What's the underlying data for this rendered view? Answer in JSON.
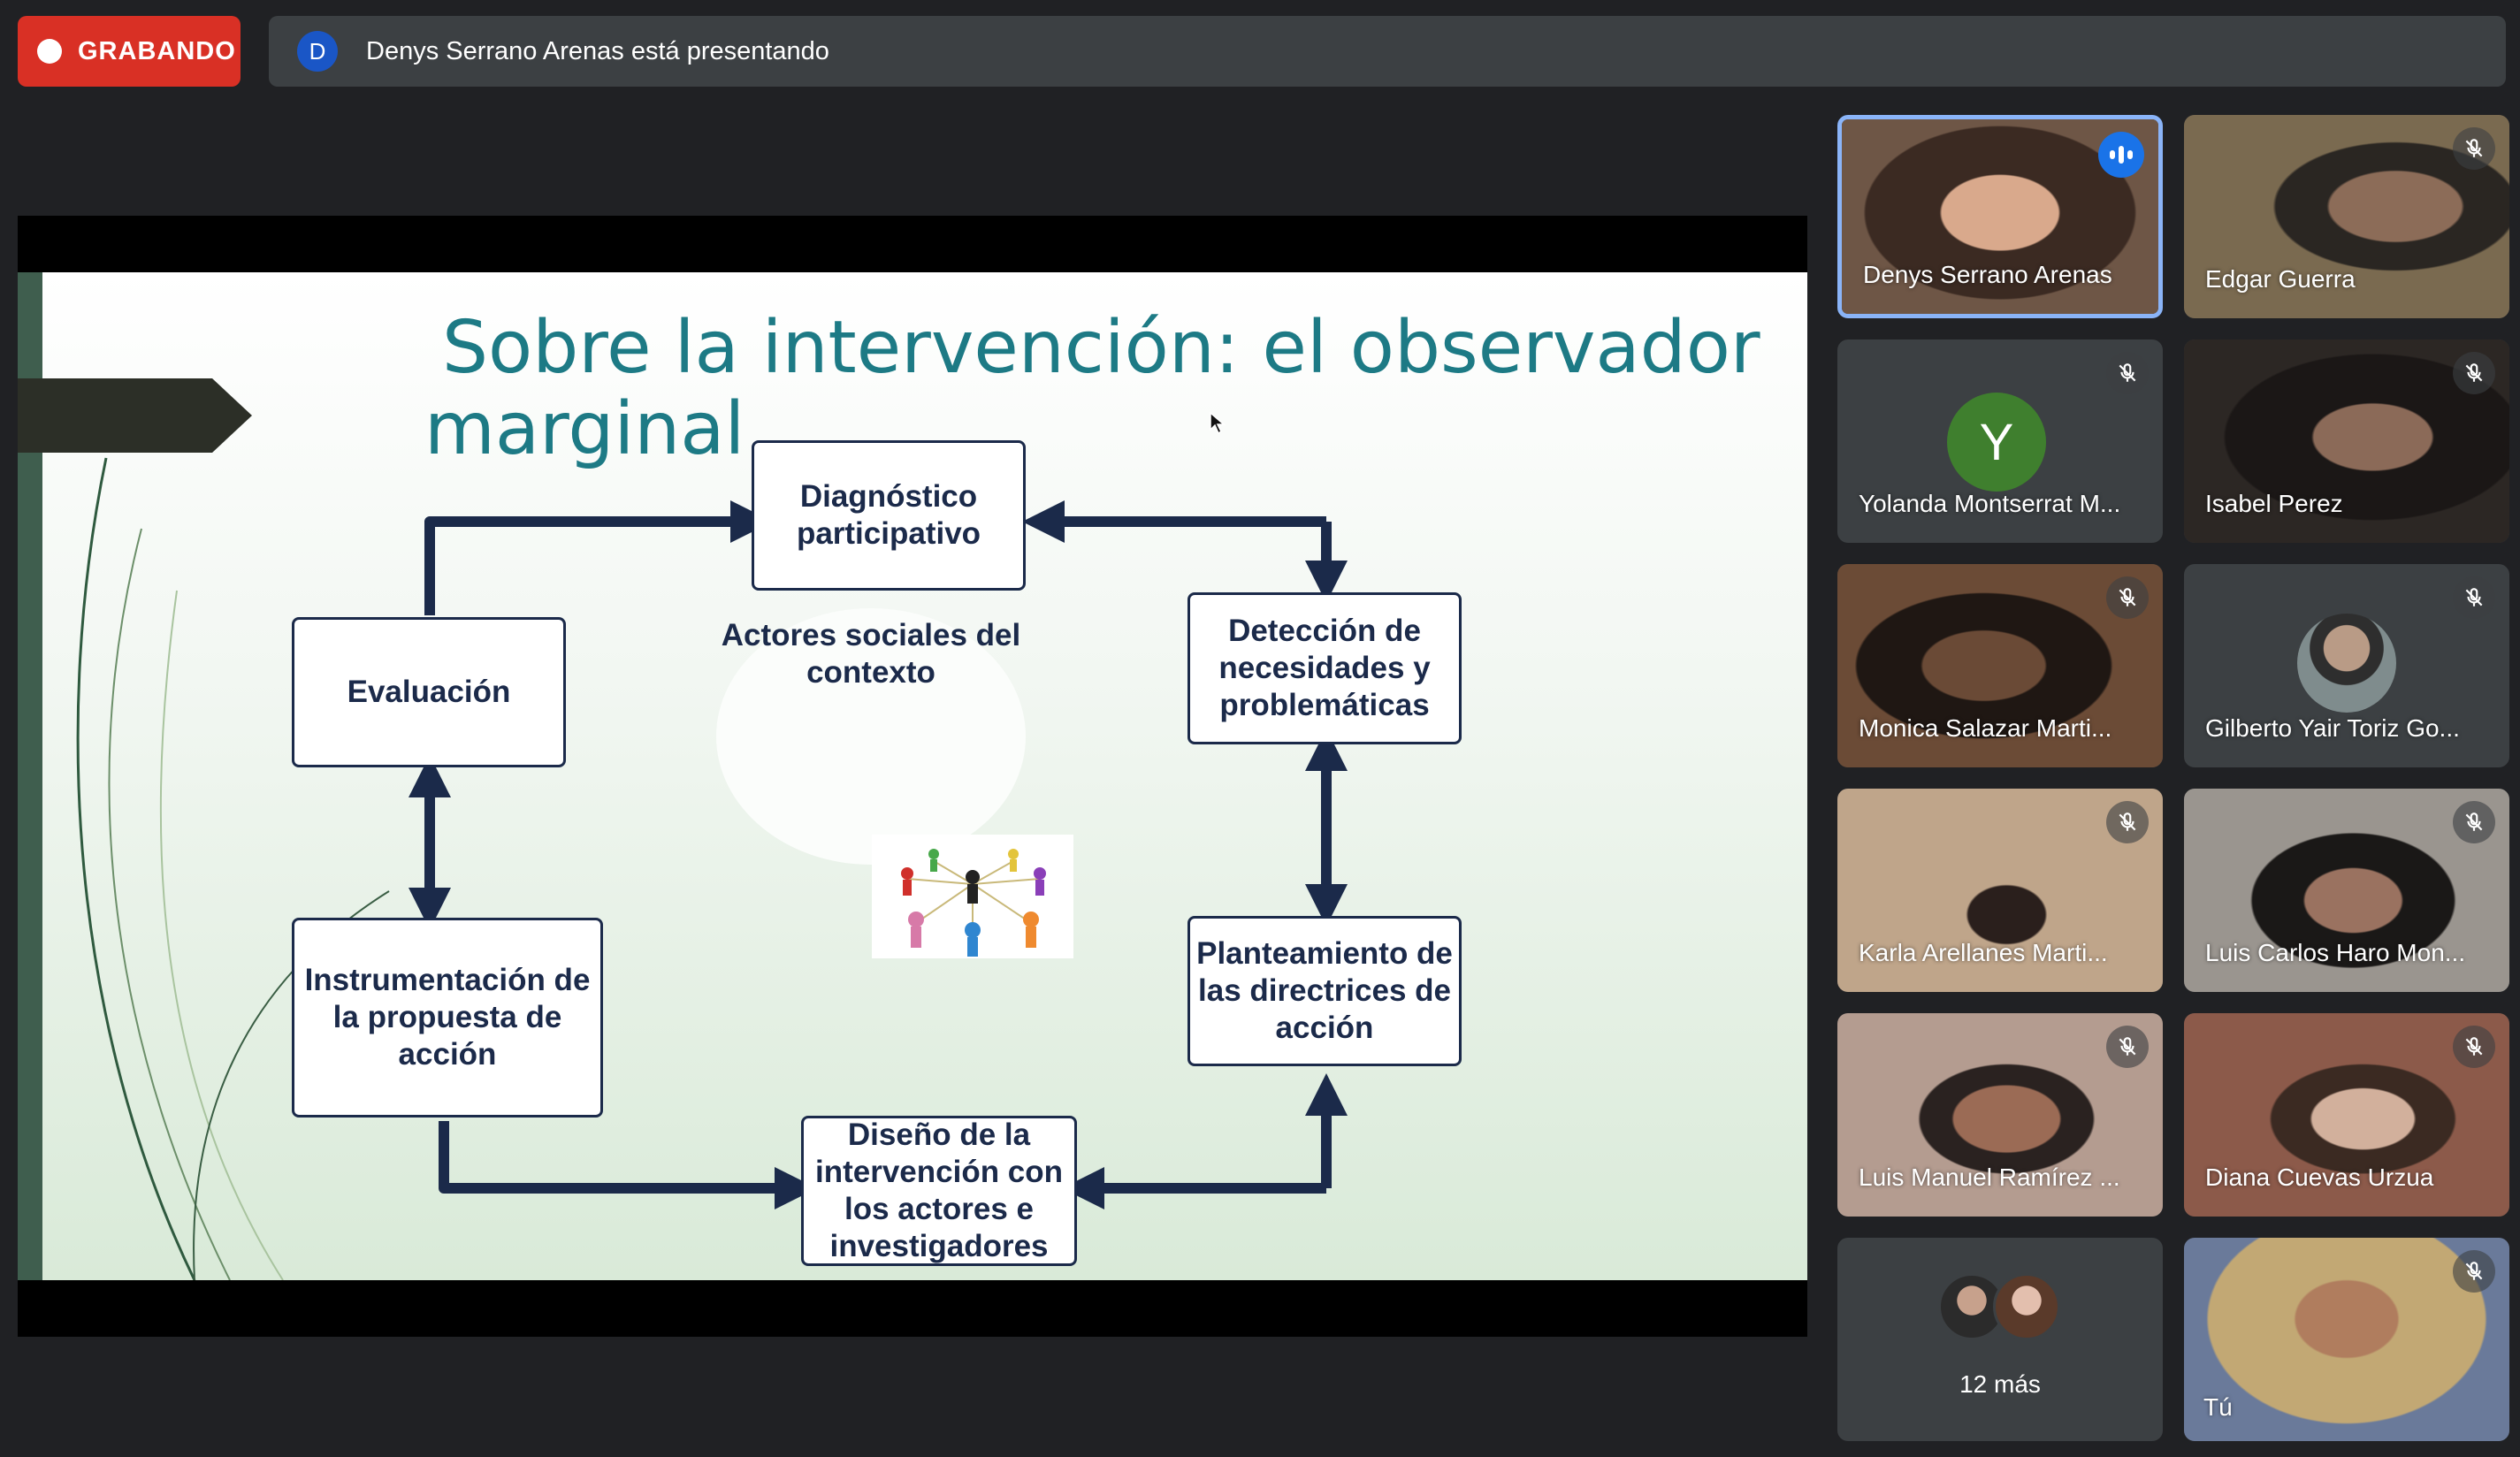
{
  "recording": {
    "label": "GRABANDO"
  },
  "presenting": {
    "avatar_letter": "D",
    "text": "Denys Serrano Arenas está presentando"
  },
  "slide": {
    "title_line1": "Sobre la intervención: el observador",
    "title_line2": "marginal.",
    "boxes": {
      "diagnostico": "Diagnóstico participativo",
      "evaluacion": "Evaluación",
      "deteccion": "Detección de necesidades y problemáticas",
      "instrumentacion": "Instrumentación de la propuesta de acción",
      "planteamiento": "Planteamiento de las directrices de acción",
      "diseno": "Diseño de la intervención con los actores e investigadores"
    },
    "center_text": "Actores sociales del contexto"
  },
  "participants": [
    {
      "name": "Denys Serrano Arenas",
      "state": "speaking",
      "bg": "#8a6a58"
    },
    {
      "name": "Edgar Guerra",
      "state": "muted",
      "bg": "#6b5a44"
    },
    {
      "name": "Yolanda Montserrat M...",
      "state": "muted",
      "avatar_letter": "Y",
      "bg": "#3c4043"
    },
    {
      "name": "Isabel Perez",
      "state": "muted",
      "bg": "#2a2522"
    },
    {
      "name": "Monica Salazar Marti...",
      "state": "muted",
      "bg": "#5a4030"
    },
    {
      "name": "Gilberto Yair Toriz Go...",
      "state": "muted",
      "bg": "#3c4043"
    },
    {
      "name": "Karla Arellanes Marti...",
      "state": "muted",
      "bg": "#c9b49c"
    },
    {
      "name": "Luis Carlos Haro Mon...",
      "state": "muted",
      "bg": "#8f8a84"
    },
    {
      "name": "Luis Manuel Ramírez ...",
      "state": "muted",
      "bg": "#a88f82"
    },
    {
      "name": "Diana Cuevas Urzua",
      "state": "muted",
      "bg": "#8c5a4a"
    }
  ],
  "more": {
    "label": "12 más"
  },
  "self": {
    "name": "Tú",
    "state": "muted",
    "bg": "#c2a874"
  },
  "colors": {
    "recording": "#d93025",
    "speaking": "#1a73e8",
    "active_border": "#8ab4f8",
    "slide_title": "#1d7a85",
    "slide_box": "#1b2a4a"
  },
  "icons": [
    "record-dot-icon",
    "mic-off-icon",
    "speaking-indicator-icon",
    "mouse-cursor-icon"
  ]
}
